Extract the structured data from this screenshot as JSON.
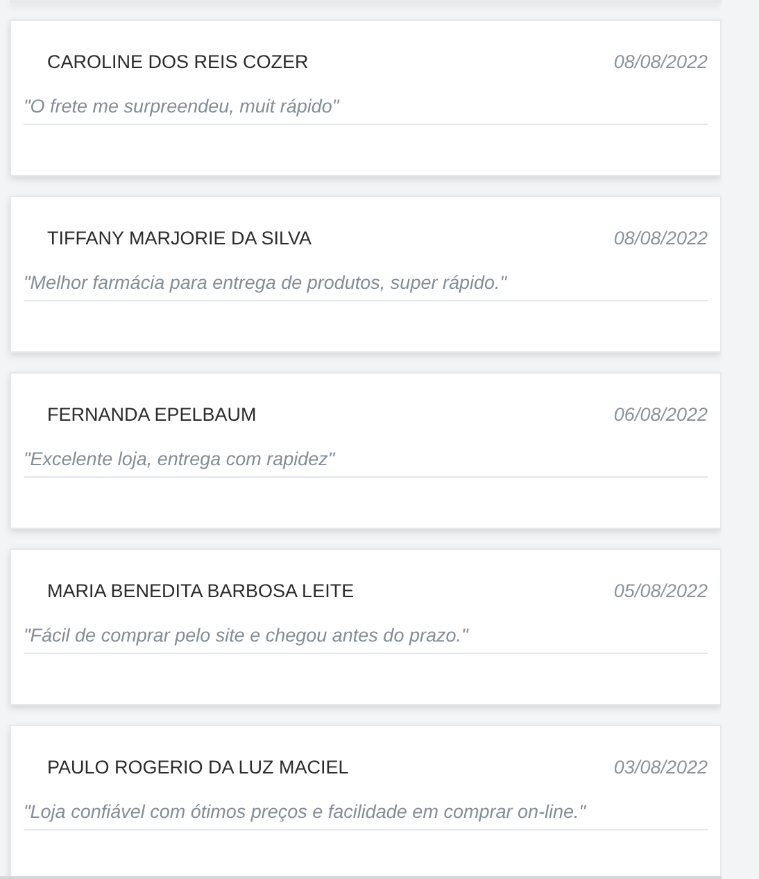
{
  "reviews": [
    {
      "name": "CAROLINE DOS REIS COZER",
      "date": "08/08/2022",
      "comment": "\"O frete me surpreendeu, muit rápido\""
    },
    {
      "name": "TIFFANY MARJORIE DA SILVA",
      "date": "08/08/2022",
      "comment": "\"Melhor farmácia para entrega de produtos, super rápido.\""
    },
    {
      "name": "FERNANDA EPELBAUM",
      "date": "06/08/2022",
      "comment": "\"Excelente loja, entrega com rapidez\""
    },
    {
      "name": "MARIA BENEDITA BARBOSA LEITE",
      "date": "05/08/2022",
      "comment": "\"Fácil de comprar pelo site e chegou antes do prazo.\""
    },
    {
      "name": "PAULO ROGERIO DA LUZ MACIEL",
      "date": "03/08/2022",
      "comment": "\"Loja confiável com ótimos preços e facilidade em comprar on-line.\""
    }
  ]
}
